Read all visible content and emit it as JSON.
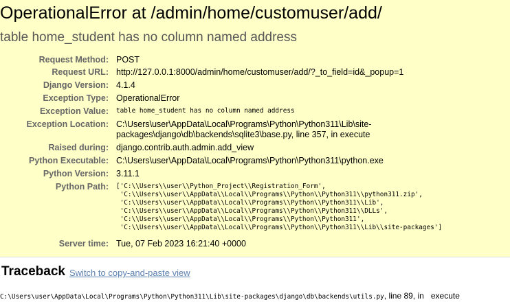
{
  "header": {
    "title": "OperationalError at /admin/home/customuser/add/",
    "subtitle": "table home_student has no column named address"
  },
  "meta": [
    {
      "label": "Request Method:",
      "value": "POST"
    },
    {
      "label": "Request URL:",
      "value": "http://127.0.0.1:8000/admin/home/customuser/add/?_to_field=id&_popup=1"
    },
    {
      "label": "Django Version:",
      "value": "4.1.4"
    },
    {
      "label": "Exception Type:",
      "value": "OperationalError"
    },
    {
      "label": "Exception Value:",
      "value": "table home_student has no column named address"
    },
    {
      "label": "Exception Location:",
      "value": "C:\\Users\\user\\AppData\\Local\\Programs\\Python\\Python311\\Lib\\site-\npackages\\django\\db\\backends\\sqlite3\\base.py, line 357, in execute"
    },
    {
      "label": "Raised during:",
      "value": "django.contrib.auth.admin.add_view"
    },
    {
      "label": "Python Executable:",
      "value": "C:\\Users\\user\\AppData\\Local\\Programs\\Python\\Python311\\python.exe"
    },
    {
      "label": "Python Version:",
      "value": "3.11.1"
    },
    {
      "label": "Python Path:",
      "value": "['C:\\\\Users\\\\user\\\\Python_Project\\\\Registration_Form',\n 'C:\\\\Users\\\\user\\\\AppData\\\\Local\\\\Programs\\\\Python\\\\Python311\\\\python311.zip',\n 'C:\\\\Users\\\\user\\\\AppData\\\\Local\\\\Programs\\\\Python\\\\Python311\\\\Lib',\n 'C:\\\\Users\\\\user\\\\AppData\\\\Local\\\\Programs\\\\Python\\\\Python311\\\\DLLs',\n 'C:\\\\Users\\\\user\\\\AppData\\\\Local\\\\Programs\\\\Python\\\\Python311',\n 'C:\\\\Users\\\\user\\\\AppData\\\\Local\\\\Programs\\\\Python\\\\Python311\\\\Lib\\\\site-packages']"
    },
    {
      "label": "Server time:",
      "value": "Tue, 07 Feb 2023 16:21:40 +0000"
    }
  ],
  "traceback": {
    "title": "Traceback",
    "switch_link": "Switch to copy-and-paste view",
    "frame_file": "C:\\Users\\user\\AppData\\Local\\Programs\\Python\\Python311\\Lib\\site-packages\\django\\db\\backends\\utils.py",
    "frame_line": ", line 89, in",
    "frame_func": "execute"
  },
  "colors": {
    "summary_background": "#ffffc8",
    "label_color": "#666666",
    "link_color": "#5b80b2"
  }
}
